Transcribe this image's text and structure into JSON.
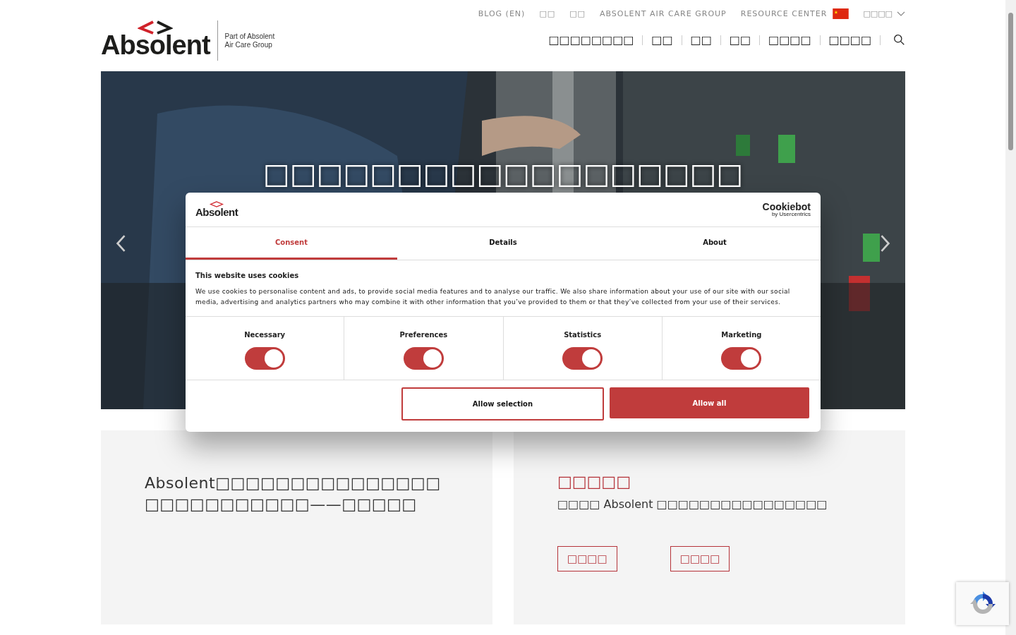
{
  "header": {
    "logo": "Absolent",
    "logo_tagline": [
      "Part of Absolent",
      "Air Care Group"
    ],
    "top_links": [
      "BLOG (EN)",
      "□□",
      "□□",
      "ABSOLENT AIR CARE GROUP",
      "RESOURCE CENTER"
    ],
    "language": "□□□□",
    "nav": [
      "□□□□□□□□",
      "□□",
      "□□",
      "□□",
      "□□□□",
      "□□□□"
    ]
  },
  "hero": {
    "title": "□□□□□□□□□□□□□□□□□□"
  },
  "cards": [
    {
      "text": "Absolent□□□□□□□□□□□□□□□□□□□□□□□□□□——□□□□□"
    },
    {
      "heading": "□□□□□",
      "text": "□□□□ Absolent □□□□□□□□□□□□□□□□",
      "buttons": [
        "□□□□",
        "□□□□"
      ]
    }
  ],
  "cookie_dialog": {
    "logo": "Absolent",
    "brand": "Cookiebot",
    "brand_sub": "by Usercentrics",
    "tabs": [
      {
        "label": "Consent",
        "selected": true
      },
      {
        "label": "Details",
        "selected": false
      },
      {
        "label": "About",
        "selected": false
      }
    ],
    "heading": "This website uses cookies",
    "body": "We use cookies to personalise content and ads, to provide social media features and to analyse our traffic. We also share information about your use of our site with our social media, advertising and analytics partners who may combine it with other information that you’ve provided to them or that they’ve collected from your use of their services.",
    "categories": [
      {
        "label": "Necessary",
        "checked": true
      },
      {
        "label": "Preferences",
        "checked": true
      },
      {
        "label": "Statistics",
        "checked": true
      },
      {
        "label": "Marketing",
        "checked": true
      }
    ],
    "buttons": [
      {
        "label": "Allow selection",
        "kind": "outline"
      },
      {
        "label": "Allow all",
        "kind": "filled"
      }
    ]
  }
}
